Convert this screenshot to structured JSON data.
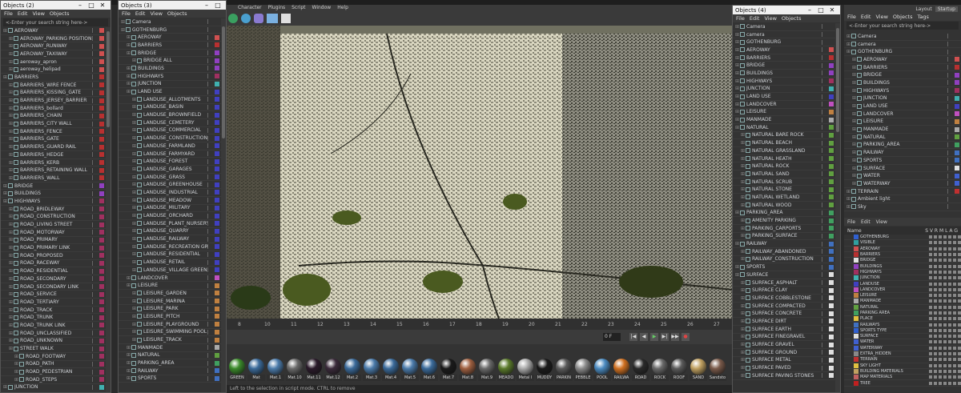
{
  "app": {
    "top_menu": [
      "Character",
      "Plugins",
      "Script",
      "Window",
      "Help"
    ]
  },
  "win1": {
    "title": "Objects (2)",
    "menu": [
      "File",
      "Edit",
      "View",
      "Objects"
    ],
    "search": "<-Enter your search string here->",
    "rows": [
      {
        "t": "AEROWAY",
        "lvl": 0,
        "c": "#d05050"
      },
      {
        "t": "AEROWAY_PARKING POSITION",
        "lvl": 1,
        "c": "#d05050"
      },
      {
        "t": "AEROWAY_RUNWAY",
        "lvl": 1,
        "c": "#d05050"
      },
      {
        "t": "AEROWAY_TAXIWAY",
        "lvl": 1,
        "c": "#d05050"
      },
      {
        "t": "aeroway_apron",
        "lvl": 1,
        "c": "#d05050"
      },
      {
        "t": "aeroway_helipad",
        "lvl": 1,
        "c": "#d05050"
      },
      {
        "t": "BARRIERS",
        "lvl": 0,
        "c": "#b83030"
      },
      {
        "t": "BARRIERS_WIRE FENCE",
        "lvl": 1,
        "c": "#b83030"
      },
      {
        "t": "BARRIERS_KISSING_GATE",
        "lvl": 1,
        "c": "#b83030"
      },
      {
        "t": "BARRIERS_JERSEY_BARRIER",
        "lvl": 1,
        "c": "#b83030"
      },
      {
        "t": "BARRIERS_bollard",
        "lvl": 1,
        "c": "#b83030"
      },
      {
        "t": "BARRIERS_CHAIN",
        "lvl": 1,
        "c": "#b83030"
      },
      {
        "t": "BARRIERS_CITY WALL",
        "lvl": 1,
        "c": "#b83030"
      },
      {
        "t": "BARRIERS_FENCE",
        "lvl": 1,
        "c": "#b83030"
      },
      {
        "t": "BARRIERS_GATE",
        "lvl": 1,
        "c": "#b83030"
      },
      {
        "t": "BARRIERS_GUARD RAIL",
        "lvl": 1,
        "c": "#b83030"
      },
      {
        "t": "BARRIERS_HEDGE",
        "lvl": 1,
        "c": "#b83030"
      },
      {
        "t": "BARRIERS_KERB",
        "lvl": 1,
        "c": "#b83030"
      },
      {
        "t": "BARRIERS_RETAINING WALL",
        "lvl": 1,
        "c": "#b83030"
      },
      {
        "t": "BARRIERS_WALL",
        "lvl": 1,
        "c": "#b83030"
      },
      {
        "t": "BRIDGE",
        "lvl": 0,
        "c": "#9040c0"
      },
      {
        "t": "BUILDINGS",
        "lvl": 0,
        "c": "#9040c0"
      },
      {
        "t": "HIGHWAYS",
        "lvl": 0,
        "c": "#a03060"
      },
      {
        "t": "ROAD_BRIDLEWAY",
        "lvl": 1,
        "c": "#a03060"
      },
      {
        "t": "ROAD_CONSTRUCTION",
        "lvl": 1,
        "c": "#a03060"
      },
      {
        "t": "ROAD_LIVING STREET",
        "lvl": 1,
        "c": "#a03060"
      },
      {
        "t": "ROAD_MOTORWAY",
        "lvl": 1,
        "c": "#a03060"
      },
      {
        "t": "ROAD_PRIMARY",
        "lvl": 1,
        "c": "#a03060"
      },
      {
        "t": "ROAD_PRIMARY LINK",
        "lvl": 1,
        "c": "#a03060"
      },
      {
        "t": "ROAD_PROPOSED",
        "lvl": 1,
        "c": "#a03060"
      },
      {
        "t": "ROAD_RACEWAY",
        "lvl": 1,
        "c": "#a03060"
      },
      {
        "t": "ROAD_RESIDENTIAL",
        "lvl": 1,
        "c": "#a03060"
      },
      {
        "t": "ROAD_SECONDARY",
        "lvl": 1,
        "c": "#a03060"
      },
      {
        "t": "ROAD_SECONDARY LINK",
        "lvl": 1,
        "c": "#a03060"
      },
      {
        "t": "ROAD_SERVICE",
        "lvl": 1,
        "c": "#a03060"
      },
      {
        "t": "ROAD_TERTIARY",
        "lvl": 1,
        "c": "#a03060"
      },
      {
        "t": "ROAD_TRACK",
        "lvl": 1,
        "c": "#a03060"
      },
      {
        "t": "ROAD_TRUNK",
        "lvl": 1,
        "c": "#a03060"
      },
      {
        "t": "ROAD_TRUNK LINK",
        "lvl": 1,
        "c": "#a03060"
      },
      {
        "t": "ROAD_UNCLASSIFIED",
        "lvl": 1,
        "c": "#a03060"
      },
      {
        "t": "ROAD_UNKNOWN",
        "lvl": 1,
        "c": "#a03060"
      },
      {
        "t": "STREET WALK",
        "lvl": 1,
        "c": "#a03060"
      },
      {
        "t": "ROAD_FOOTWAY",
        "lvl": 2,
        "c": "#a03060"
      },
      {
        "t": "ROAD_PATH",
        "lvl": 2,
        "c": "#a03060"
      },
      {
        "t": "ROAD_PEDESTRIAN",
        "lvl": 2,
        "c": "#a03060"
      },
      {
        "t": "ROAD_STEPS",
        "lvl": 2,
        "c": "#a03060"
      },
      {
        "t": "JUNCTION",
        "lvl": 0,
        "c": "#40b0b0"
      }
    ]
  },
  "win2": {
    "title": "Objects (3)",
    "menu": [
      "File",
      "Edit",
      "View",
      "Objects"
    ],
    "rows": [
      {
        "t": "Camera",
        "lvl": 0,
        "c": ""
      },
      {
        "t": "GOTHENBURG",
        "lvl": 0,
        "c": ""
      },
      {
        "t": "AEROWAY",
        "lvl": 1,
        "c": "#d05050"
      },
      {
        "t": "BARRIERS",
        "lvl": 1,
        "c": "#b83030"
      },
      {
        "t": "BRIDGE",
        "lvl": 1,
        "c": "#9040c0"
      },
      {
        "t": "BRIDGE ALL",
        "lvl": 2,
        "c": "#9040c0"
      },
      {
        "t": "BUILDINGS",
        "lvl": 1,
        "c": "#9040c0"
      },
      {
        "t": "HIGHWAYS",
        "lvl": 1,
        "c": "#a03060"
      },
      {
        "t": "JUNCTION",
        "lvl": 1,
        "c": "#40b0b0"
      },
      {
        "t": "LAND USE",
        "lvl": 1,
        "c": "#4040c0"
      },
      {
        "t": "LANDUSE_ALLOTMENTS",
        "lvl": 2,
        "c": "#4040c0"
      },
      {
        "t": "LANDUSE_BASIN",
        "lvl": 2,
        "c": "#4040c0"
      },
      {
        "t": "LANDUSE_BROWNFIELD",
        "lvl": 2,
        "c": "#4040c0"
      },
      {
        "t": "LANDUSE_CEMETERY",
        "lvl": 2,
        "c": "#4040c0"
      },
      {
        "t": "LANDUSE_COMMERCIAL",
        "lvl": 2,
        "c": "#4040c0"
      },
      {
        "t": "LANDUSE_CONSTRUCTION",
        "lvl": 2,
        "c": "#4040c0"
      },
      {
        "t": "LANDUSE_FARMLAND",
        "lvl": 2,
        "c": "#4040c0"
      },
      {
        "t": "LANDUSE_FARMYARD",
        "lvl": 2,
        "c": "#4040c0"
      },
      {
        "t": "LANDUSE_FOREST",
        "lvl": 2,
        "c": "#4040c0"
      },
      {
        "t": "LANDUSE_GARAGES",
        "lvl": 2,
        "c": "#4040c0"
      },
      {
        "t": "LANDUSE_GRASS",
        "lvl": 2,
        "c": "#4040c0"
      },
      {
        "t": "LANDUSE_GREENHOUSE",
        "lvl": 2,
        "c": "#4040c0"
      },
      {
        "t": "LANDUSE_INDUSTRIAL",
        "lvl": 2,
        "c": "#4040c0"
      },
      {
        "t": "LANDUSE_MEADOW",
        "lvl": 2,
        "c": "#4040c0"
      },
      {
        "t": "LANDUSE_MILITARY",
        "lvl": 2,
        "c": "#4040c0"
      },
      {
        "t": "LANDUSE_ORCHARD",
        "lvl": 2,
        "c": "#4040c0"
      },
      {
        "t": "LANDUSE_PLANT_NURSERY",
        "lvl": 2,
        "c": "#4040c0"
      },
      {
        "t": "LANDUSE_QUARRY",
        "lvl": 2,
        "c": "#4040c0"
      },
      {
        "t": "LANDUSE_RAILWAY",
        "lvl": 2,
        "c": "#4040c0"
      },
      {
        "t": "LANDUSE_RECREATION GROUND",
        "lvl": 2,
        "c": "#4040c0"
      },
      {
        "t": "LANDUSE_RESIDENTIAL",
        "lvl": 2,
        "c": "#4040c0"
      },
      {
        "t": "LANDUSE_RETAIL",
        "lvl": 2,
        "c": "#4040c0"
      },
      {
        "t": "LANDUSE_VILLAGE GREEN",
        "lvl": 2,
        "c": "#4040c0"
      },
      {
        "t": "LANDCOVER",
        "lvl": 1,
        "c": "#c050c0"
      },
      {
        "t": "LEISURE",
        "lvl": 1,
        "c": "#c08040"
      },
      {
        "t": "LEISURE_GARDEN",
        "lvl": 2,
        "c": "#c08040"
      },
      {
        "t": "LEISURE_MARINA",
        "lvl": 2,
        "c": "#c08040"
      },
      {
        "t": "LEISURE_PARK",
        "lvl": 2,
        "c": "#c08040"
      },
      {
        "t": "LEISURE_PITCH",
        "lvl": 2,
        "c": "#c08040"
      },
      {
        "t": "LEISURE_PLAYGROUND",
        "lvl": 2,
        "c": "#c08040"
      },
      {
        "t": "LEISURE_SWIMMING POOL",
        "lvl": 2,
        "c": "#c08040"
      },
      {
        "t": "LEISURE_TRACK",
        "lvl": 2,
        "c": "#c08040"
      },
      {
        "t": "MANMADE",
        "lvl": 1,
        "c": "#aaaaaa"
      },
      {
        "t": "NATURAL",
        "lvl": 1,
        "c": "#60a040"
      },
      {
        "t": "PARKING_AREA",
        "lvl": 1,
        "c": "#40a060"
      },
      {
        "t": "RAILWAY",
        "lvl": 1,
        "c": "#4070c0"
      },
      {
        "t": "SPORTS",
        "lvl": 1,
        "c": "#4070c0"
      }
    ]
  },
  "win3": {
    "title": "Objects (4)",
    "menu": [
      "File",
      "Edit",
      "View",
      "Objects"
    ],
    "rows": [
      {
        "t": "Camera",
        "lvl": 0,
        "c": ""
      },
      {
        "t": "camera",
        "lvl": 0,
        "c": ""
      },
      {
        "t": "GOTHENBURG",
        "lvl": 0,
        "c": ""
      },
      {
        "t": "AEROWAY",
        "lvl": 0,
        "c": "#d05050"
      },
      {
        "t": "BARRIERS",
        "lvl": 0,
        "c": "#b83030"
      },
      {
        "t": "BRIDGE",
        "lvl": 0,
        "c": "#9040c0"
      },
      {
        "t": "BUILDINGS",
        "lvl": 0,
        "c": "#9040c0"
      },
      {
        "t": "HIGHWAYS",
        "lvl": 0,
        "c": "#a03060"
      },
      {
        "t": "JUNCTION",
        "lvl": 0,
        "c": "#40b0b0"
      },
      {
        "t": "LAND USE",
        "lvl": 0,
        "c": "#4040c0"
      },
      {
        "t": "LANDCOVER",
        "lvl": 0,
        "c": "#c050c0"
      },
      {
        "t": "LEISURE",
        "lvl": 0,
        "c": "#c08040"
      },
      {
        "t": "MANMADE",
        "lvl": 0,
        "c": "#aaaaaa"
      },
      {
        "t": "NATURAL",
        "lvl": 0,
        "c": "#60a040"
      },
      {
        "t": "NATURAL BARE ROCK",
        "lvl": 1,
        "c": "#60a040"
      },
      {
        "t": "NATURAL BEACH",
        "lvl": 1,
        "c": "#60a040"
      },
      {
        "t": "NATURAL GRASSLAND",
        "lvl": 1,
        "c": "#60a040"
      },
      {
        "t": "NATURAL HEATH",
        "lvl": 1,
        "c": "#60a040"
      },
      {
        "t": "NATURAL ROCK",
        "lvl": 1,
        "c": "#60a040"
      },
      {
        "t": "NATURAL SAND",
        "lvl": 1,
        "c": "#60a040"
      },
      {
        "t": "NATURAL SCRUB",
        "lvl": 1,
        "c": "#60a040"
      },
      {
        "t": "NATURAL STONE",
        "lvl": 1,
        "c": "#60a040"
      },
      {
        "t": "NATURAL WETLAND",
        "lvl": 1,
        "c": "#60a040"
      },
      {
        "t": "NATURAL WOOD",
        "lvl": 1,
        "c": "#60a040"
      },
      {
        "t": "PARKING_AREA",
        "lvl": 0,
        "c": "#40a060"
      },
      {
        "t": "AMENITY PARKING",
        "lvl": 1,
        "c": "#40a060"
      },
      {
        "t": "PARKING_CARPORTS",
        "lvl": 1,
        "c": "#40a060"
      },
      {
        "t": "PARKING_SURFACE",
        "lvl": 1,
        "c": "#40a060"
      },
      {
        "t": "RAILWAY",
        "lvl": 0,
        "c": "#4070c0"
      },
      {
        "t": "RAILWAY_ABANDONED",
        "lvl": 1,
        "c": "#4070c0"
      },
      {
        "t": "RAILWAY_CONSTRUCTION",
        "lvl": 1,
        "c": "#4070c0"
      },
      {
        "t": "SPORTS",
        "lvl": 0,
        "c": "#4070c0"
      },
      {
        "t": "SURFACE",
        "lvl": 0,
        "c": "#e0e0e0"
      },
      {
        "t": "SURFACE_ASPHALT",
        "lvl": 1,
        "c": "#e0e0e0"
      },
      {
        "t": "SURFACE CLAY",
        "lvl": 1,
        "c": "#e0e0e0"
      },
      {
        "t": "SURFACE COBBLESTONE",
        "lvl": 1,
        "c": "#e0e0e0"
      },
      {
        "t": "SURFACE COMPACTED",
        "lvl": 1,
        "c": "#e0e0e0"
      },
      {
        "t": "SURFACE CONCRETE",
        "lvl": 1,
        "c": "#e0e0e0"
      },
      {
        "t": "SURFACE DIRT",
        "lvl": 1,
        "c": "#e0e0e0"
      },
      {
        "t": "SURFACE EARTH",
        "lvl": 1,
        "c": "#e0e0e0"
      },
      {
        "t": "SURFACE FINEGRAVEL",
        "lvl": 1,
        "c": "#e0e0e0"
      },
      {
        "t": "SURFACE GRAVEL",
        "lvl": 1,
        "c": "#e0e0e0"
      },
      {
        "t": "SURFACE GROUND",
        "lvl": 1,
        "c": "#e0e0e0"
      },
      {
        "t": "SURFACE METAL",
        "lvl": 1,
        "c": "#e0e0e0"
      },
      {
        "t": "SURFACE PAVED",
        "lvl": 1,
        "c": "#e0e0e0"
      },
      {
        "t": "SURFACE PAVING STONES",
        "lvl": 1,
        "c": "#e0e0e0"
      }
    ]
  },
  "win4": {
    "title_left": "Layout",
    "title_right": "Startup",
    "menu": [
      "File",
      "Edit",
      "View",
      "Objects",
      "Tags"
    ],
    "search": "<-Enter your search string here->",
    "rows": [
      {
        "t": "Camera",
        "lvl": 0,
        "c": ""
      },
      {
        "t": "camera",
        "lvl": 0,
        "c": ""
      },
      {
        "t": "GOTHENBURG",
        "lvl": 0,
        "c": ""
      },
      {
        "t": "AEROWAY",
        "lvl": 1,
        "c": "#d05050"
      },
      {
        "t": "BARRIERS",
        "lvl": 1,
        "c": "#b83030"
      },
      {
        "t": "BRIDGE",
        "lvl": 1,
        "c": "#9040c0"
      },
      {
        "t": "BUILDINGS",
        "lvl": 1,
        "c": "#9040c0"
      },
      {
        "t": "HIGHWAYS",
        "lvl": 1,
        "c": "#a03060"
      },
      {
        "t": "JUNCTION",
        "lvl": 1,
        "c": "#40b0b0"
      },
      {
        "t": "LAND USE",
        "lvl": 1,
        "c": "#4040c0"
      },
      {
        "t": "LANDCOVER",
        "lvl": 1,
        "c": "#c050c0"
      },
      {
        "t": "LEISURE",
        "lvl": 1,
        "c": "#c08040"
      },
      {
        "t": "MANMADE",
        "lvl": 1,
        "c": "#aaaaaa"
      },
      {
        "t": "NATURAL",
        "lvl": 1,
        "c": "#60a040"
      },
      {
        "t": "PARKING_AREA",
        "lvl": 1,
        "c": "#40a060"
      },
      {
        "t": "RAILWAY",
        "lvl": 1,
        "c": "#4070c0"
      },
      {
        "t": "SPORTS",
        "lvl": 1,
        "c": "#4070c0"
      },
      {
        "t": "SURFACE",
        "lvl": 1,
        "c": "#e0e0e0"
      },
      {
        "t": "WATER",
        "lvl": 1,
        "c": "#4060d0"
      },
      {
        "t": "WATERWAY",
        "lvl": 1,
        "c": "#4060d0"
      },
      {
        "t": "TERRAIN",
        "lvl": 0,
        "c": "#c03030"
      },
      {
        "t": "Ambient light",
        "lvl": 0,
        "c": ""
      },
      {
        "t": "Sky",
        "lvl": 0,
        "c": ""
      }
    ],
    "layer_menu": [
      "File",
      "Edit",
      "View"
    ],
    "layer_header": {
      "name": "Name",
      "cols": "S V R M L A G"
    },
    "layers": [
      {
        "t": "GOTHENBURG",
        "c": "#3060d0"
      },
      {
        "t": "VISIBLE",
        "c": "#30a0a0"
      },
      {
        "t": "AEROWAY",
        "c": "#d05050"
      },
      {
        "t": "BARRIERS",
        "c": "#b83030"
      },
      {
        "t": "BRIDGE",
        "c": "#e0e0e0"
      },
      {
        "t": "BUILDINGS",
        "c": "#9040c0"
      },
      {
        "t": "HIGHWAYS",
        "c": "#a03060"
      },
      {
        "t": "JUNCTION",
        "c": "#40b0b0"
      },
      {
        "t": "LANDUSE",
        "c": "#4040c0"
      },
      {
        "t": "LANDCOVER",
        "c": "#c050c0"
      },
      {
        "t": "LEISURE",
        "c": "#c08040"
      },
      {
        "t": "MANMADE",
        "c": "#aaaaaa"
      },
      {
        "t": "NATURAL",
        "c": "#60a040"
      },
      {
        "t": "PARKING AREA",
        "c": "#40a060"
      },
      {
        "t": "PLACE",
        "c": "#e0c040"
      },
      {
        "t": "RAILWAYS",
        "c": "#4070c0"
      },
      {
        "t": "SPORTS TYPE",
        "c": "#3060d0"
      },
      {
        "t": "SURFACE",
        "c": "#e0e0e0"
      },
      {
        "t": "WATER",
        "c": "#4060d0"
      },
      {
        "t": "WATERWAY",
        "c": "#4060d0"
      },
      {
        "t": "EXTRA_HIDDEN",
        "c": "#888888"
      },
      {
        "t": "TERRAIN",
        "c": "#c03030"
      },
      {
        "t": "SKY LIGHT",
        "c": "#e0c040"
      },
      {
        "t": "BUILDING MATERIALS",
        "c": "#c0a060"
      },
      {
        "t": "MAP MATERIALS",
        "c": "#c06060"
      },
      {
        "t": "TREE",
        "c": "#c02020"
      }
    ]
  },
  "timeline": {
    "ticks": [
      "8",
      "10",
      "11",
      "12",
      "13",
      "14",
      "15",
      "16",
      "17",
      "18",
      "19",
      "20",
      "21",
      "22",
      "23",
      "24",
      "25",
      "26",
      "27"
    ],
    "frame_field": "0 F"
  },
  "materials": [
    {
      "t": "GREEN",
      "c": "#3a8a2a"
    },
    {
      "t": "Mat",
      "c": "#3a6a9a"
    },
    {
      "t": "Mat.1",
      "c": "#4a7aaa"
    },
    {
      "t": "Mat.10",
      "c": "#6a6a6a"
    },
    {
      "t": "Mat.11",
      "c": "#2a1a2a"
    },
    {
      "t": "Mat.12",
      "c": "#3a2a3a"
    },
    {
      "t": "Mat.2",
      "c": "#3a6a9a"
    },
    {
      "t": "Mat.3",
      "c": "#4a7aaa"
    },
    {
      "t": "Mat.4",
      "c": "#3a6a9a"
    },
    {
      "t": "Mat.5",
      "c": "#4a7aaa"
    },
    {
      "t": "Mat.6",
      "c": "#3a6a9a"
    },
    {
      "t": "Mat.7",
      "c": "#1a1a1a"
    },
    {
      "t": "Mat.8",
      "c": "#a06040"
    },
    {
      "t": "Mat.9",
      "c": "#6a6a6a"
    },
    {
      "t": "MEADO",
      "c": "#5a7a2a"
    },
    {
      "t": "Metal I",
      "c": "#aaaaaa"
    },
    {
      "t": "MUDDY",
      "c": "#1a1a1a"
    },
    {
      "t": "PARKIN",
      "c": "#5a5a5a"
    },
    {
      "t": "PEBBLE",
      "c": "#8a8a8a"
    },
    {
      "t": "POOL",
      "c": "#4a8ac0"
    },
    {
      "t": "RAILWA",
      "c": "#d07020"
    },
    {
      "t": "ROAD",
      "c": "#2a2a2a"
    },
    {
      "t": "ROCK",
      "c": "#6a6a6a"
    },
    {
      "t": "ROOF",
      "c": "#5a5a5a"
    },
    {
      "t": "SAND",
      "c": "#c0a060"
    },
    {
      "t": "Sandsto",
      "c": "#7a5a4a"
    }
  ],
  "status": "Left to the selection in script mode. CTRL to remove"
}
